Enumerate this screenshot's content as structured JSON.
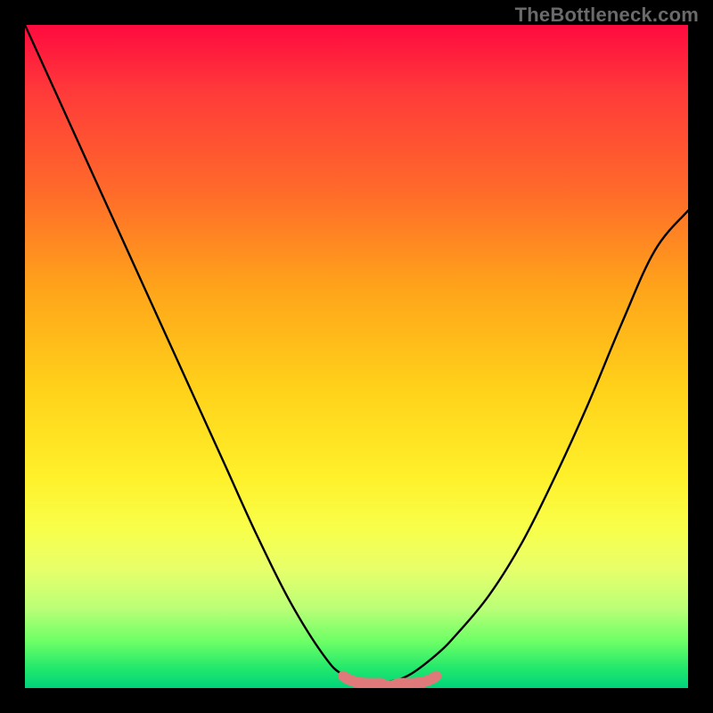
{
  "brand": "TheBottleneck.com",
  "colors": {
    "frame_background": "#000000",
    "curve_stroke": "#000000",
    "marker_stroke": "#e07a7a"
  },
  "chart_data": {
    "type": "line",
    "title": "",
    "xlabel": "",
    "ylabel": "",
    "xlim": [
      0,
      100
    ],
    "ylim": [
      0,
      100
    ],
    "grid": false,
    "legend": false,
    "series": [
      {
        "name": "bottleneck-curve",
        "x": [
          0,
          5,
          10,
          15,
          20,
          25,
          30,
          35,
          40,
          45,
          48,
          52,
          55,
          58,
          62,
          65,
          70,
          75,
          80,
          85,
          90,
          95,
          100
        ],
        "y": [
          100,
          89,
          78,
          67,
          56,
          45,
          34,
          23,
          13,
          5,
          2,
          1,
          1,
          2,
          5,
          8,
          14,
          22,
          32,
          43,
          55,
          66,
          72
        ]
      }
    ],
    "marker": {
      "name": "optimal-range",
      "x_range": [
        48,
        62
      ],
      "y": 1
    }
  }
}
